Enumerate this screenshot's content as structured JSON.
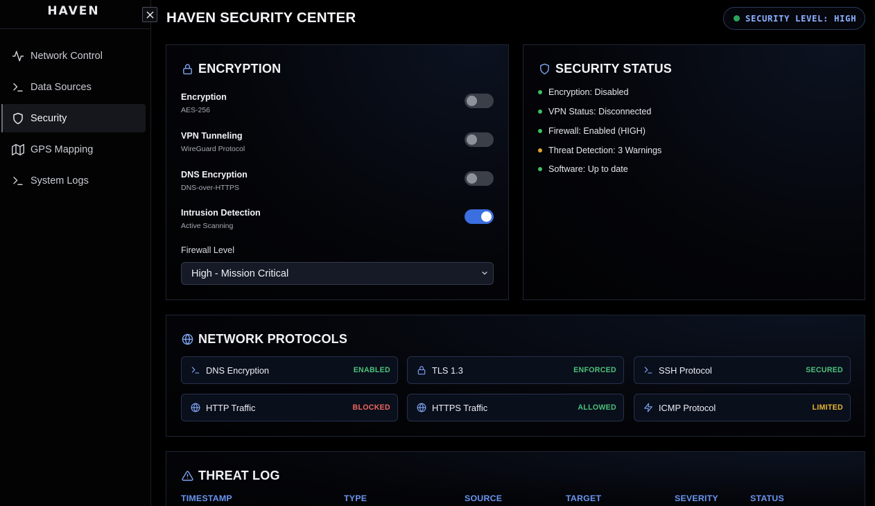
{
  "app": {
    "logo": "HAVEN",
    "title": "HAVEN SECURITY CENTER"
  },
  "sidebar": {
    "items": [
      {
        "label": "Network Control",
        "icon": "activity-icon"
      },
      {
        "label": "Data Sources",
        "icon": "terminal-icon"
      },
      {
        "label": "Security",
        "icon": "shield-icon",
        "active": true
      },
      {
        "label": "GPS Mapping",
        "icon": "map-icon"
      },
      {
        "label": "System Logs",
        "icon": "terminal-icon"
      }
    ]
  },
  "header": {
    "security_level": "SECURITY LEVEL: HIGH",
    "security_color": "#2aa55a"
  },
  "encryption": {
    "title": "ENCRYPTION",
    "settings": [
      {
        "label": "Encryption",
        "sub": "AES-256",
        "on": false
      },
      {
        "label": "VPN Tunneling",
        "sub": "WireGuard Protocol",
        "on": false
      },
      {
        "label": "DNS Encryption",
        "sub": "DNS-over-HTTPS",
        "on": false
      },
      {
        "label": "Intrusion Detection",
        "sub": "Active Scanning",
        "on": true
      }
    ],
    "firewall_label": "Firewall Level",
    "firewall_value": "High - Mission Critical"
  },
  "status": {
    "title": "SECURITY STATUS",
    "items": [
      {
        "text": "Encryption: Disabled",
        "color": "#3fbf63"
      },
      {
        "text": "VPN Status: Disconnected",
        "color": "#3fbf63"
      },
      {
        "text": "Firewall: Enabled (HIGH)",
        "color": "#3fbf63"
      },
      {
        "text": "Threat Detection: 3 Warnings",
        "color": "#e0a528"
      },
      {
        "text": "Software: Up to date",
        "color": "#3fbf63"
      }
    ]
  },
  "protocols": {
    "title": "NETWORK PROTOCOLS",
    "items": [
      {
        "name": "DNS Encryption",
        "status": "ENABLED",
        "icon": "terminal-icon",
        "color": "#4cc27a"
      },
      {
        "name": "TLS 1.3",
        "status": "ENFORCED",
        "icon": "lock-icon",
        "color": "#4cc27a"
      },
      {
        "name": "SSH Protocol",
        "status": "SECURED",
        "icon": "terminal-icon",
        "color": "#4cc27a"
      },
      {
        "name": "HTTP Traffic",
        "status": "BLOCKED",
        "icon": "globe-icon",
        "color": "#f0665e"
      },
      {
        "name": "HTTPS Traffic",
        "status": "ALLOWED",
        "icon": "globe-icon",
        "color": "#4cc27a"
      },
      {
        "name": "ICMP Protocol",
        "status": "LIMITED",
        "icon": "zap-icon",
        "color": "#e6b531"
      }
    ]
  },
  "threat_log": {
    "title": "THREAT LOG",
    "columns": [
      "TIMESTAMP",
      "TYPE",
      "SOURCE",
      "TARGET",
      "SEVERITY",
      "STATUS"
    ]
  }
}
